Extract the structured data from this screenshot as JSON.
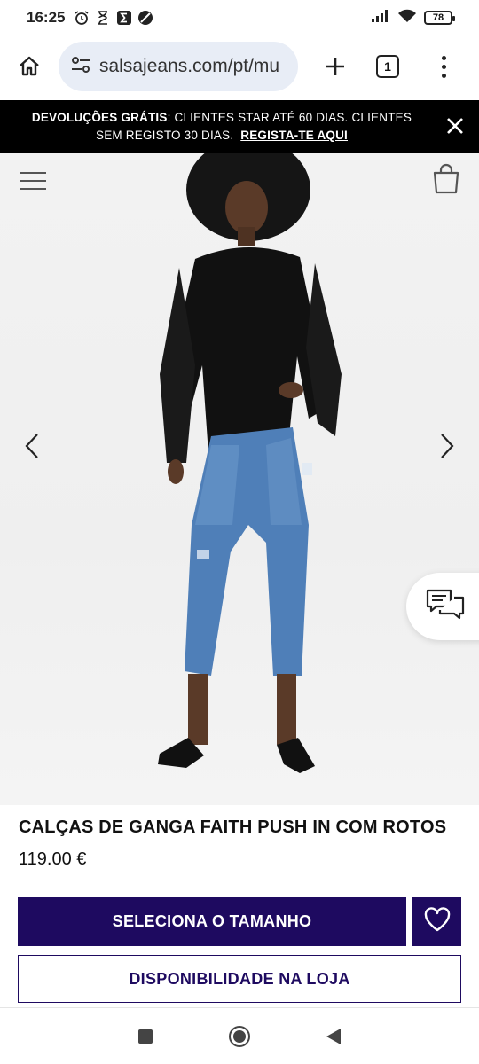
{
  "status_bar": {
    "time": "16:25",
    "battery": "78",
    "icons": [
      "alarm-icon",
      "timer-icon",
      "sigma-icon",
      "circle-app-icon",
      "signal-icon",
      "wifi-icon",
      "battery-icon"
    ]
  },
  "browser": {
    "url": "salsajeans.com/pt/mu",
    "tab_count": "1",
    "icons": [
      "home-icon",
      "site-settings-icon",
      "new-tab-icon",
      "tabs-icon",
      "more-menu-icon"
    ]
  },
  "promo": {
    "bold_text": "DEVOLUÇÕES GRÁTIS",
    "text": ": CLIENTES STAR ATÉ 60 DIAS. CLIENTES SEM REGISTO 30 DIAS.",
    "link": "REGISTA-TE AQUI",
    "background": "#000000"
  },
  "gallery": {
    "icons": [
      "hamburger-menu-icon",
      "shopping-bag-icon",
      "chevron-left-icon",
      "chevron-right-icon",
      "chat-icon"
    ]
  },
  "product": {
    "title": "CALÇAS DE GANGA FAITH PUSH IN COM ROTOS",
    "price": "119.00 €"
  },
  "actions": {
    "select_size": "SELECIONA O TAMANHO",
    "store_availability": "DISPONIBILIDADE NA LOJA",
    "accent_color": "#1e0a60"
  },
  "nav": {
    "icons": [
      "recents-icon",
      "home-nav-icon",
      "back-icon"
    ]
  }
}
